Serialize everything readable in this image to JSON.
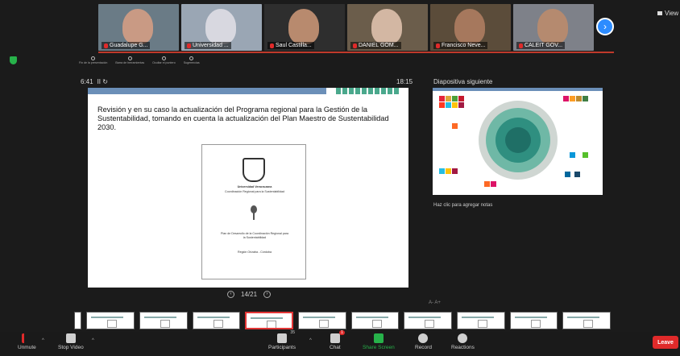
{
  "video_strip": {
    "participants": [
      {
        "name": "Guadalupe G...",
        "bg": "#6a7b86",
        "skin": "#c99a84"
      },
      {
        "name": "Universidad ...",
        "bg": "#9aa6b4",
        "skin": "#d8d8e0"
      },
      {
        "name": "Saul Castilla...",
        "bg": "#2e2e2e",
        "skin": "#b88a6e"
      },
      {
        "name": "DANIEL GÓM...",
        "bg": "#6b5d4b",
        "skin": "#d3b7a3"
      },
      {
        "name": "Francisco Neve...",
        "bg": "#5b4c3a",
        "skin": "#a6785d"
      },
      {
        "name": "CALEIT GOV...",
        "bg": "#7e8189",
        "skin": "#b58a6f"
      }
    ],
    "next_icon": "chevron-right-icon",
    "view_label": "View"
  },
  "presenter": {
    "tools": [
      "Fin de la presentación",
      "Barra de herramientas",
      "Ocultar el puntero",
      "Sugerencias"
    ],
    "timer": "6:41",
    "timer_controls": "II ↻",
    "clock": "18:15",
    "next_slide_label": "Diapositiva siguiente",
    "notes_placeholder": "Haz clic para agregar notas",
    "font_controls": "A-  A+",
    "pager": {
      "current": "14/21",
      "prev_icon": "prev-slide-icon",
      "next_icon": "next-slide-icon"
    }
  },
  "slide": {
    "title": "Revisión y en su caso la actualización del Programa regional para la Gestión de la Sustentabilidad, tomando en cuenta la actualización del Plan Maestro de Sustentabilidad 2030.",
    "doc_university": "Universidad Veracruzana",
    "doc_subtitle": "Coordinación Regional para la Sustentabilidad",
    "doc_plan": "Plan de Desarrollo de la Coordinación Regional para la Sustentabilidad",
    "doc_place": "Región Orizaba - Córdoba"
  },
  "thumbnail_count": 11,
  "active_thumbnail": 4,
  "toolbar": {
    "unmute": "Unmute",
    "stop_video": "Stop Video",
    "participants": "Participants",
    "participant_count": "35",
    "chat": "Chat",
    "chat_badge": "1",
    "share_screen": "Share Screen",
    "record": "Record",
    "reactions": "Reactions",
    "leave": "Leave"
  },
  "colors": {
    "accent": "#2d8cff",
    "share": "#27b24a",
    "leave": "#e02a2a"
  }
}
